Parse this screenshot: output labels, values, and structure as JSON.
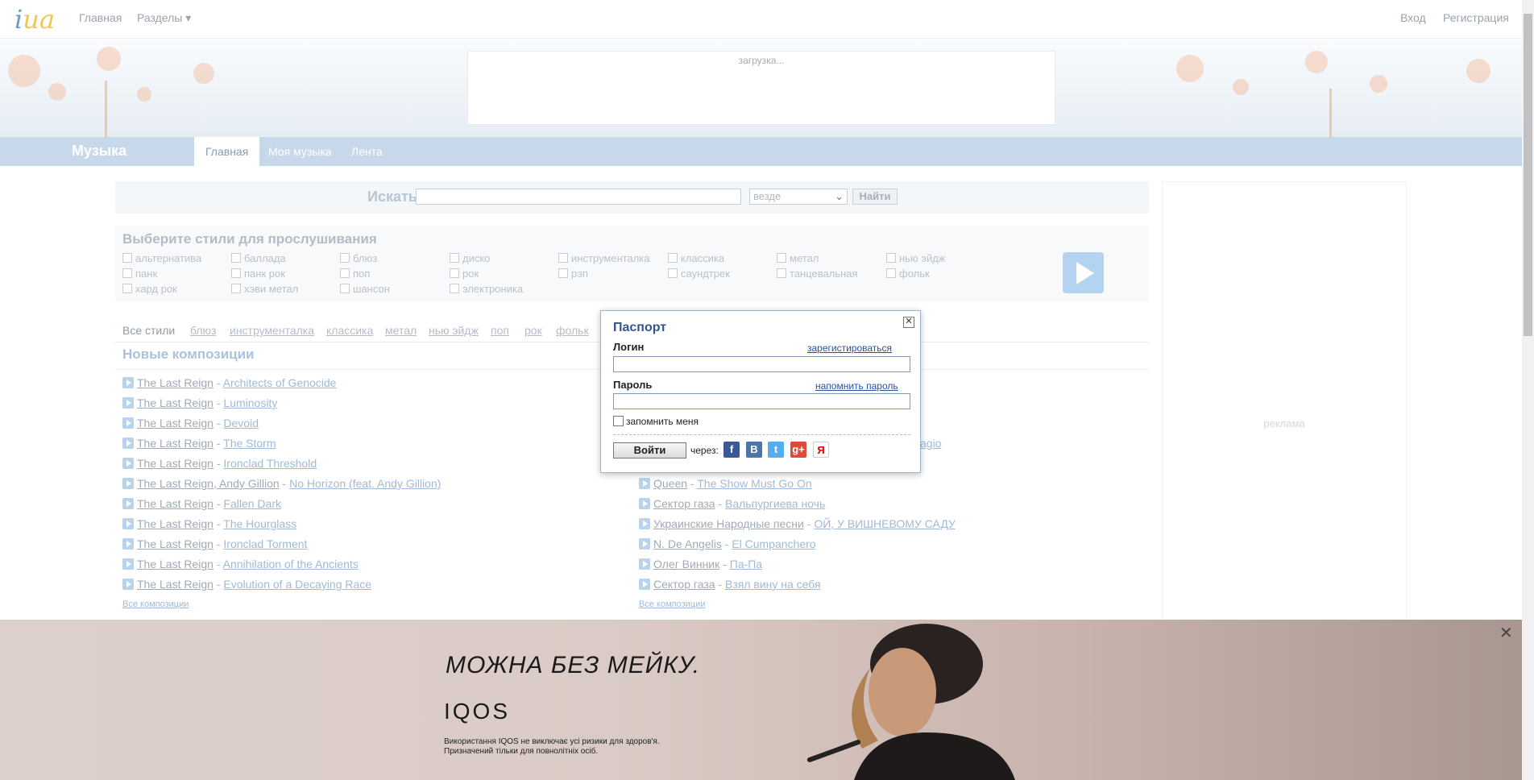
{
  "topbar": {
    "logo_i": "i",
    "logo_ua": "ua",
    "nav_home": "Главная",
    "nav_sections": "Разделы ▾",
    "nav_login": "Вход",
    "nav_register": "Регистрация"
  },
  "banner": {
    "loading": "загрузка..."
  },
  "section": {
    "title": "Музыка",
    "tabs": [
      "Главная",
      "Моя музыка",
      "Лента"
    ],
    "active_tab": "Главная"
  },
  "search": {
    "label": "Искать",
    "input_value": "",
    "select_value": "везде",
    "button": "Найти"
  },
  "styles": {
    "title": "Выберите стили для прослушивания",
    "rows": [
      [
        "альтернатива",
        "баллада",
        "блюз",
        "диско",
        "инструменталка",
        "классика",
        "метал",
        "нью эйдж"
      ],
      [
        "панк",
        "панк рок",
        "поп",
        "рок",
        "рэп",
        "саундтрек",
        "танцевальная",
        "фольк"
      ],
      [
        "хард рок",
        "хэви метал",
        "шансон",
        "электроника"
      ]
    ]
  },
  "genre_tabs": [
    "Все стили",
    "блюз",
    "инструменталка",
    "классика",
    "метал",
    "нью эйдж",
    "поп",
    "рок",
    "фольк"
  ],
  "new_tracks": {
    "title": "Новые композиции",
    "left": [
      {
        "artist": "The Last Reign",
        "song": "Architects of Genocide"
      },
      {
        "artist": "The Last Reign",
        "song": "Luminosity"
      },
      {
        "artist": "The Last Reign",
        "song": "Devoid"
      },
      {
        "artist": "The Last Reign",
        "song": "The Storm"
      },
      {
        "artist": "The Last Reign",
        "song": "Ironclad Threshold"
      },
      {
        "artist": "The Last Reign, Andy Gillion",
        "song": "No Horizon (feat. Andy Gillion)"
      },
      {
        "artist": "The Last Reign",
        "song": "Fallen Dark"
      },
      {
        "artist": "The Last Reign",
        "song": "The Hourglass"
      },
      {
        "artist": "The Last Reign",
        "song": "Ironclad Torment"
      },
      {
        "artist": "The Last Reign",
        "song": "Annihilation of the Ancients"
      },
      {
        "artist": "The Last Reign",
        "song": "Evolution of a Decaying Race"
      }
    ],
    "right_partial": "agio",
    "right": [
      {
        "artist": "Queen",
        "song": "The Show Must Go On"
      },
      {
        "artist": "Сектор газа",
        "song": "Вальпургиева ночь"
      },
      {
        "artist": "Украинские Народные песни",
        "song": "ОЙ, У ВИШНЕВОМУ САДУ"
      },
      {
        "artist": "N. De Angelis",
        "song": "El Cumpanchero"
      },
      {
        "artist": "Олег Винник",
        "song": "Па-Па"
      },
      {
        "artist": "Сектор газа",
        "song": "Взял вину на себя"
      }
    ],
    "all_link": "Все композиции"
  },
  "right_ad": {
    "label": "реклама"
  },
  "modal": {
    "title": "Паспорт",
    "close": "✕",
    "login_label": "Логин",
    "register_link": "зарегистироваться",
    "password_label": "Пароль",
    "remind_link": "напомнить пароль",
    "remember": "запомнить меня",
    "submit": "Войти",
    "via": "через:",
    "socials": [
      {
        "icon": "facebook-icon",
        "glyph": "f",
        "color": "#3b5998"
      },
      {
        "icon": "vkontakte-icon",
        "glyph": "B",
        "color": "#4a76a8"
      },
      {
        "icon": "twitter-icon",
        "glyph": "t",
        "color": "#55acee"
      },
      {
        "icon": "google-plus-icon",
        "glyph": "g+",
        "color": "#dd4b39"
      },
      {
        "icon": "yandex-icon",
        "glyph": "Я",
        "color": "#ffffff"
      }
    ]
  },
  "bottom_ad": {
    "close": "✕",
    "headline": "МОЖНА БЕЗ МЕЙКУ.",
    "brand": "IQOS",
    "disclaimer": "Використання IQOS не виключає усі ризики для здоров'я. Призначений тільки для повнолітніх осіб."
  }
}
